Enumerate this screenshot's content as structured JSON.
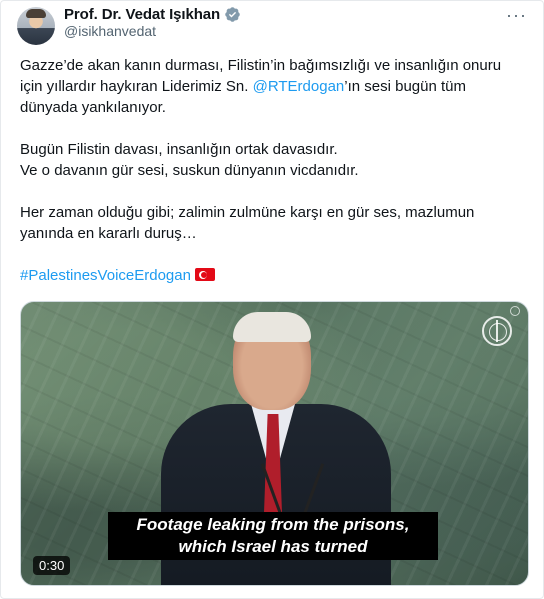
{
  "author": {
    "name": "Prof. Dr. Vedat Işıkhan",
    "handle": "@isikhanvedat",
    "verified_icon": "verified-badge-icon"
  },
  "menu": {
    "more_icon": "more-horizontal-icon",
    "more_glyph": "···"
  },
  "tweet": {
    "p1_a": "Gazze’de akan kanın durması, Filistin’in bağımsızlığı ve insanlığın onuru için yıllardır haykıran Liderimiz Sn. ",
    "mention": "@RTErdogan",
    "p1_b": "’ın sesi bugün tüm dünyada yankılanıyor.",
    "p2_l1": "Bugün Filistin davası, insanlığın ortak davasıdır.",
    "p2_l2": "Ve o davanın gür sesi, suskun dünyanın vicdanıdır.",
    "p3": "Her zaman olduğu gibi; zalimin zulmüne karşı en gür ses, mazlumun yanında en kararlı duruş…",
    "hashtag": "#PalestinesVoiceErdogan",
    "flag_icon": "turkey-flag-icon"
  },
  "video": {
    "subtitle_l1": "Footage leaking from the prisons,",
    "subtitle_l2": "which Israel has turned",
    "duration": "0:30",
    "logo_icon": "un-emblem-icon"
  },
  "colors": {
    "link": "#1d9bf0",
    "text": "#0f1419",
    "muted": "#536471",
    "verified": "#829aab"
  }
}
